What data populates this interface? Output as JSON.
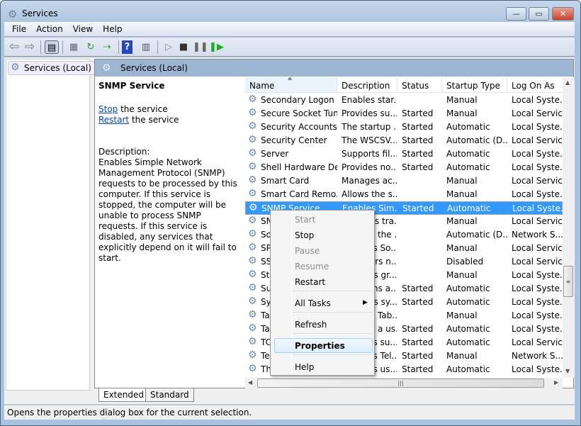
{
  "window": {
    "title": "Services",
    "minimize": "—",
    "maximize": "▭",
    "close": "✕"
  },
  "menu": [
    "File",
    "Action",
    "View",
    "Help"
  ],
  "toolbar": {
    "icons": [
      "back-arrow-icon",
      "forward-arrow-icon",
      "show-hide-console-tree-icon",
      "properties-icon",
      "refresh-icon",
      "export-list-icon",
      "help-icon",
      "show-action-pane-icon",
      "start-service-icon",
      "stop-service-icon",
      "pause-service-icon",
      "restart-service-icon"
    ]
  },
  "tree": {
    "root": "Services (Local)"
  },
  "pane": {
    "header": "Services (Local)"
  },
  "detail": {
    "title": "SNMP Service",
    "stop_link": "Stop",
    "stop_rest": " the service",
    "restart_link": "Restart",
    "restart_rest": " the service",
    "description_label": "Description:",
    "description": "Enables Simple Network Management Protocol (SNMP) requests to be processed by this computer. If this service is stopped, the computer will be unable to process SNMP requests. If this service is disabled, any services that explicitly depend on it will fail to start."
  },
  "columns": [
    "Name",
    "Description",
    "Status",
    "Startup Type",
    "Log On As"
  ],
  "rows": [
    [
      "Secondary Logon",
      "Enables star...",
      "",
      "Manual",
      "Local Syste..."
    ],
    [
      "Secure Socket Tun...",
      "Provides su...",
      "Started",
      "Manual",
      "Local Service"
    ],
    [
      "Security Accounts...",
      "The startup ...",
      "Started",
      "Automatic",
      "Local Syste..."
    ],
    [
      "Security Center",
      "The WSCSV...",
      "Started",
      "Automatic (D...",
      "Local Service"
    ],
    [
      "Server",
      "Supports fil...",
      "Started",
      "Automatic",
      "Local Syste..."
    ],
    [
      "Shell Hardware De...",
      "Provides no...",
      "Started",
      "Automatic",
      "Local Syste..."
    ],
    [
      "Smart Card",
      "Manages ac...",
      "",
      "Manual",
      "Local Service"
    ],
    [
      "Smart Card Remo...",
      "Allows the s...",
      "",
      "Manual",
      "Local Syste..."
    ],
    [
      "SNMP Service",
      "Enables Sim...",
      "Started",
      "Automatic",
      "Local Syste..."
    ],
    [
      "SNMP Trap",
      "Receives tra...",
      "",
      "Manual",
      "Local Service"
    ],
    [
      "Software Protection",
      "Enables the ...",
      "",
      "Automatic (D...",
      "Network S..."
    ],
    [
      "SPP Notification...",
      "Provides So...",
      "",
      "Manual",
      "Local Service"
    ],
    [
      "SSDP Discovery",
      "Discovers n...",
      "",
      "Disabled",
      "Local Service"
    ],
    [
      "Storage Service",
      "Enforces gr...",
      "",
      "Manual",
      "Local Syste..."
    ],
    [
      "Superfetch",
      "Maintains a...",
      "Started",
      "Automatic",
      "Local Syste..."
    ],
    [
      "System Event No...",
      "Monitors sy...",
      "Started",
      "Automatic",
      "Local Syste..."
    ],
    [
      "Tablet PC Input S...",
      "Enables Tab...",
      "",
      "Manual",
      "Local Syste..."
    ],
    [
      "Task Scheduler",
      "Enables a us...",
      "Started",
      "Automatic",
      "Local Syste..."
    ],
    [
      "TCP/IP NetBIOS H...",
      "Provides su...",
      "Started",
      "Automatic",
      "Local Service"
    ],
    [
      "Telephony",
      "Provides Tel...",
      "Started",
      "Manual",
      "Network S..."
    ],
    [
      "Themes",
      "Provides us...",
      "Started",
      "Automatic",
      "Local Syste..."
    ]
  ],
  "selected_row": 8,
  "context_menu": [
    {
      "label": "Start",
      "disabled": true
    },
    {
      "label": "Stop"
    },
    {
      "label": "Pause",
      "disabled": true
    },
    {
      "label": "Resume",
      "disabled": true
    },
    {
      "label": "Restart"
    },
    {
      "label": "All Tasks",
      "submenu": true
    },
    {
      "label": "Refresh"
    },
    {
      "label": "Properties",
      "highlighted": true
    },
    {
      "label": "Help"
    }
  ],
  "tabs": [
    "Extended",
    "Standard"
  ],
  "active_tab": "Extended",
  "status": "Opens the properties dialog box for the current selection.",
  "colors": {
    "selection": "#3399ff",
    "header_band": "#9cb5d1",
    "link": "#0645ad"
  }
}
